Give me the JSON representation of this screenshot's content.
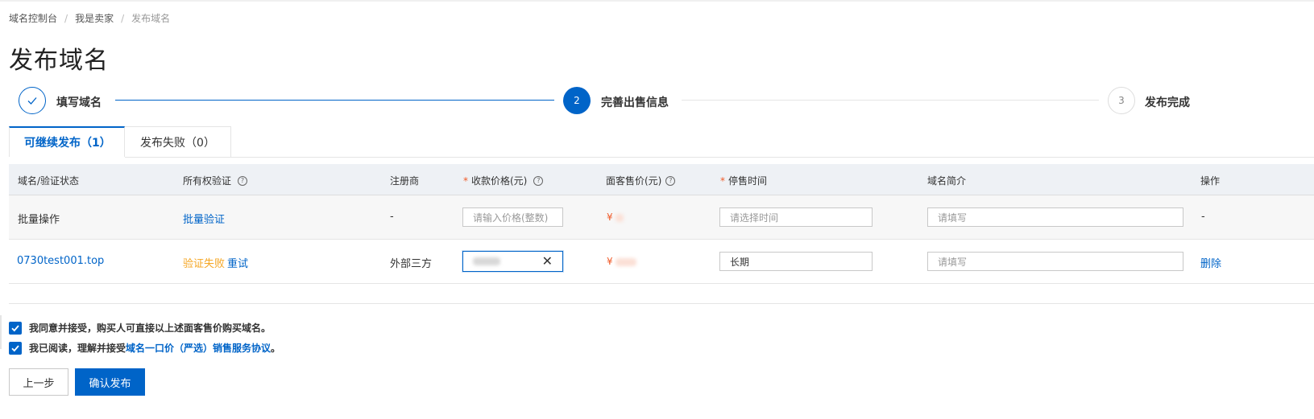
{
  "breadcrumb": {
    "items": [
      "域名控制台",
      "我是卖家"
    ],
    "current": "发布域名",
    "separator": "/"
  },
  "page_title": "发布域名",
  "steps": [
    {
      "label": "填写域名",
      "number": "",
      "status": "done"
    },
    {
      "label": "完善出售信息",
      "number": "2",
      "status": "active"
    },
    {
      "label": "发布完成",
      "number": "3",
      "status": "pending"
    }
  ],
  "tabs": [
    {
      "label": "可继续发布（1）",
      "active": true
    },
    {
      "label": "发布失败（0）",
      "active": false
    }
  ],
  "table": {
    "headers": {
      "domain": "域名/验证状态",
      "ownership": "所有权验证",
      "registrar": "注册商",
      "price": "收款价格(元)",
      "sale_price": "面客售价(元)",
      "stop_time": "停售时间",
      "intro": "域名简介",
      "actions": "操作"
    },
    "batch_row": {
      "label": "批量操作",
      "ownership": "批量验证",
      "registrar": "-",
      "price_placeholder": "请输入价格(整数)",
      "sale_price_prefix": "¥",
      "stop_time_placeholder": "请选择时间",
      "intro_placeholder": "请填写",
      "actions": "-"
    },
    "rows": [
      {
        "domain": "0730test001.top",
        "verify_status": "验证失败",
        "retry": "重试",
        "registrar": "外部三方",
        "sale_price_prefix": "¥",
        "stop_time": "长期",
        "intro_placeholder": "请填写",
        "action": "删除"
      }
    ]
  },
  "agreements": {
    "first": "我同意并接受，购买人可直接以上述面客售价购买域名。",
    "second_prefix": "我已阅读，理解并接受",
    "second_link": "域名一口价（严选）销售服务协议",
    "second_suffix": "。"
  },
  "buttons": {
    "prev": "上一步",
    "submit": "确认发布"
  },
  "colors": {
    "primary": "#0064c8",
    "warning": "#f5a623",
    "price": "#f05a28",
    "required": "#f05a28"
  },
  "icons": {
    "step_done": "check-icon",
    "help": "question-circle-icon",
    "clear": "close-icon",
    "checkbox": "checkmark-icon"
  }
}
